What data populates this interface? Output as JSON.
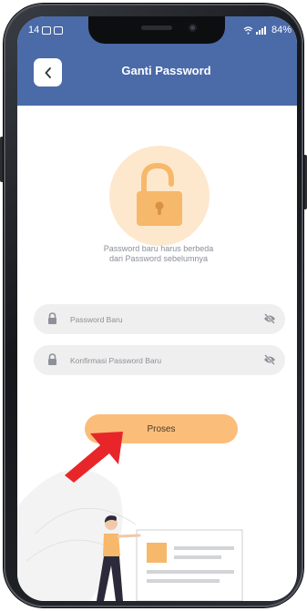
{
  "status_bar": {
    "time": "14",
    "battery": "84%"
  },
  "header": {
    "title": "Ganti Password"
  },
  "info_text": {
    "line1": "Password baru harus berbeda",
    "line2": "dari Password sebelumnya"
  },
  "form": {
    "new_password_placeholder": "Password Baru",
    "confirm_password_placeholder": "Konfirmasi Password Baru"
  },
  "submit": {
    "label": "Proses"
  },
  "colors": {
    "header_bg": "#4a6aa8",
    "accent": "#fbbd7a",
    "lock_circle": "#fde8cd",
    "lock_icon": "#f6b86a",
    "arrow": "#e8262a"
  },
  "icons": [
    "back-chevron-icon",
    "lock-icon",
    "eye-slash-icon",
    "signal-icon",
    "wifi-icon"
  ]
}
